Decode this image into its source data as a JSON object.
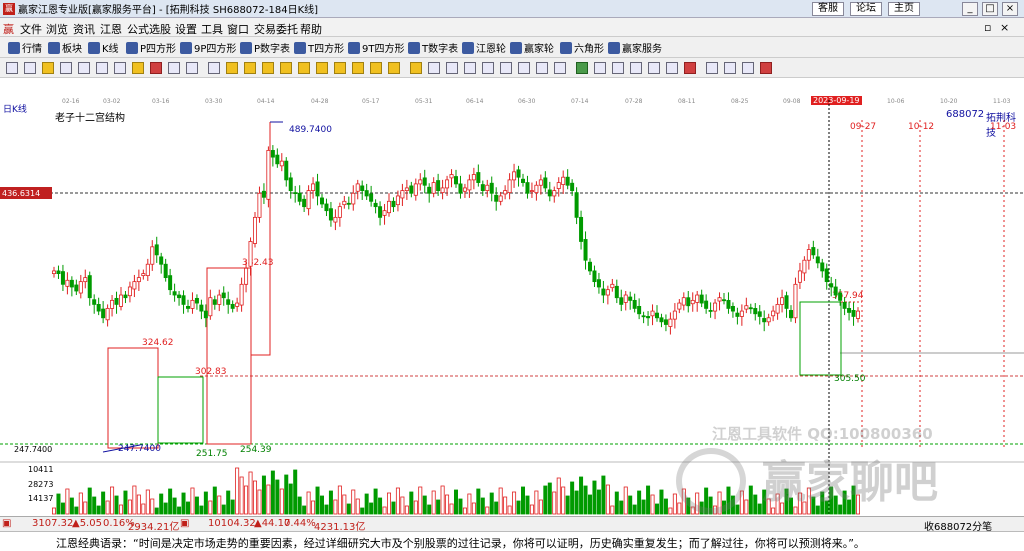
{
  "window": {
    "title": "赢家江恩专业版[赢家服务平台] - [拓荆科技  SH688072-184日K线]",
    "links": [
      "客服",
      "论坛",
      "主页"
    ]
  },
  "menu": [
    "文件",
    "浏览",
    "资讯",
    "江恩",
    "公式选股",
    "设置",
    "工具",
    "窗口",
    "交易委托",
    "帮助"
  ],
  "toolbar": [
    "行情",
    "板块",
    "K线",
    "P四方形",
    "9P四方形",
    "P数字表",
    "T四方形",
    "9T四方形",
    "T数字表",
    "江恩轮",
    "赢家轮",
    "六角形",
    "赢家服务"
  ],
  "date_ticks": [
    "02-16",
    "03-02",
    "03-16",
    "03-30",
    "04-14",
    "04-28",
    "05-17",
    "05-31",
    "06-14",
    "06-30",
    "07-14",
    "07-28",
    "08-11",
    "08-25",
    "09-08",
    "2023-09-19",
    "10-06",
    "10-20",
    "11-03"
  ],
  "chart": {
    "period": "日K线",
    "study": "老子十二宫结构",
    "code": "688072",
    "name": "拓荆科技",
    "cursor_price": "436.6314",
    "axis_low": "247.7400",
    "cycle_dates": [
      "09-27",
      "10-12",
      "11-03"
    ],
    "price_labels": [
      "489.7400",
      "382.43",
      "324.62",
      "302.83",
      "247.7400",
      "251.75",
      "254.39",
      "357.94",
      "305.50"
    ],
    "volume_labels": [
      "10411",
      "28273",
      "14137"
    ]
  },
  "watermark": {
    "line1": "江恩工具软件  QQ:100800360",
    "line2": "赢家聊吧"
  },
  "status": {
    "sh_index": "3107.32",
    "sh_change": "▲5.05",
    "sh_pct": "0.16%",
    "sh_amount": "2934.21亿",
    "sz_index": "10104.32",
    "sz_change": "▲44.17",
    "sz_pct": "0.44%",
    "sz_amount": "4231.13亿",
    "right_note": "收688072分笔"
  },
  "quote": "江恩经典语录：“时间是决定市场走势的重要因素，经过详细研究大市及个别股票的过往记录，你将可以证明，历史确实重复发生；而了解过往，你将可以预测将来。”。",
  "colors": {
    "up": "#e02020",
    "down": "#009a00",
    "axis": "#000080"
  }
}
